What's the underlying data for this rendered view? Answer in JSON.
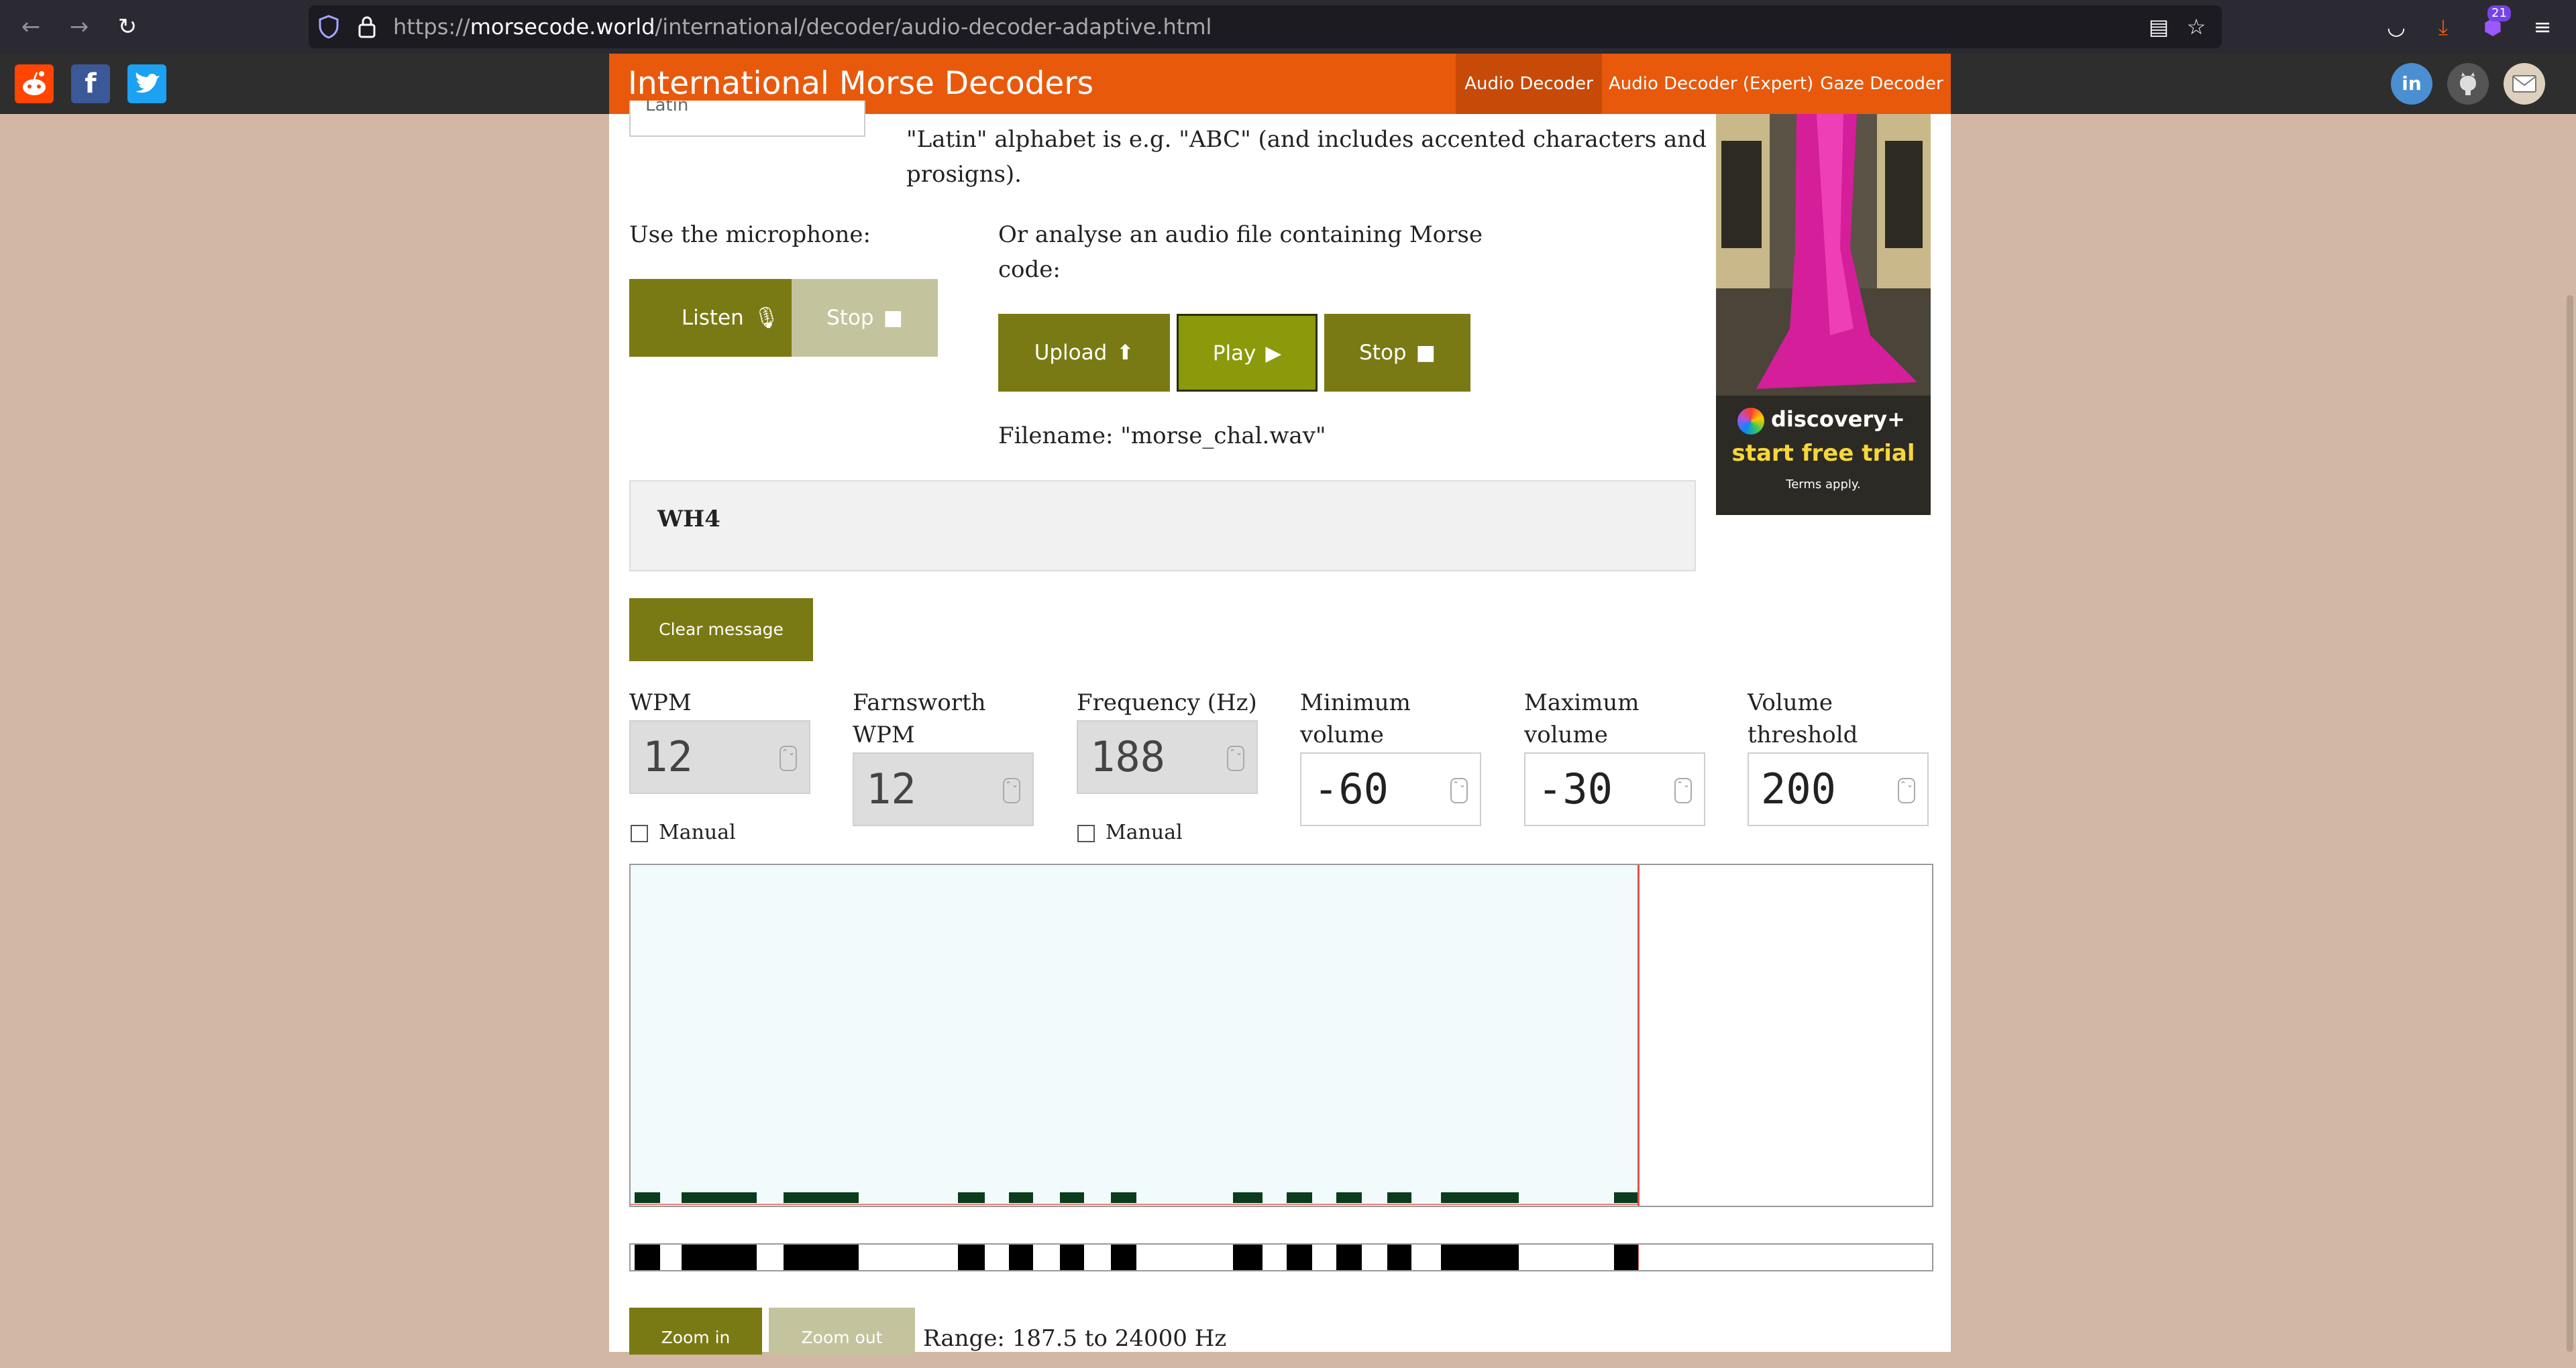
{
  "browser": {
    "url_prefix": "https://",
    "url_domain": "morsecode.world",
    "url_path": "/international/decoder/audio-decoder-adaptive.html",
    "extension_badge": "21"
  },
  "site": {
    "title": "International Morse Decoders",
    "nav": [
      "Audio Decoder",
      "Audio Decoder (Expert)",
      "Gaze Decoder"
    ],
    "active_nav": "Audio Decoder",
    "social": {
      "linkedin": "in"
    }
  },
  "alphabet": {
    "select_value": "Latin",
    "description_line1": "\"Latin\" alphabet is e.g. \"ABC\" (and includes accented characters and",
    "description_line2": "prosigns)."
  },
  "microphone": {
    "label": "Use the microphone:",
    "listen_label": "Listen",
    "stop_label": "Stop"
  },
  "file": {
    "label_line1": "Or analyse an audio file containing Morse",
    "label_line2": "code:",
    "upload_label": "Upload",
    "play_label": "Play",
    "stop_label": "Stop",
    "filename_text": "Filename: \"morse_chal.wav\""
  },
  "output": {
    "decoded_text": "WH4",
    "clear_label": "Clear message"
  },
  "controls": {
    "wpm": {
      "label": "WPM",
      "value": "12",
      "manual_label": "Manual"
    },
    "farnsworth": {
      "label_line1": "Farnsworth",
      "label_line2": "WPM",
      "value": "12"
    },
    "frequency": {
      "label": "Frequency (Hz)",
      "value": "188",
      "manual_label": "Manual"
    },
    "min_volume": {
      "label_line1": "Minimum",
      "label_line2": "volume",
      "value": "-60"
    },
    "max_volume": {
      "label_line1": "Maximum",
      "label_line2": "volume",
      "value": "-30"
    },
    "threshold": {
      "label_line1": "Volume",
      "label_line2": "threshold",
      "value": "200"
    }
  },
  "ad": {
    "brand": "discovery+",
    "cta": "start free trial",
    "terms": "Terms apply."
  },
  "spectrogram": {
    "background": "#f2fbfb",
    "signal_color": "#0b3d1c",
    "cursor_color": "#e05050"
  },
  "zoom": {
    "zoom_in_label": "Zoom in",
    "zoom_out_label": "Zoom out",
    "range_text": "Range: 187.5 to 24000 Hz"
  },
  "colors": {
    "button": "#7a7a14",
    "button_active": "#8a9a0a",
    "button_disabled": "#c3c39e",
    "nav_orange": "#e8590c"
  }
}
